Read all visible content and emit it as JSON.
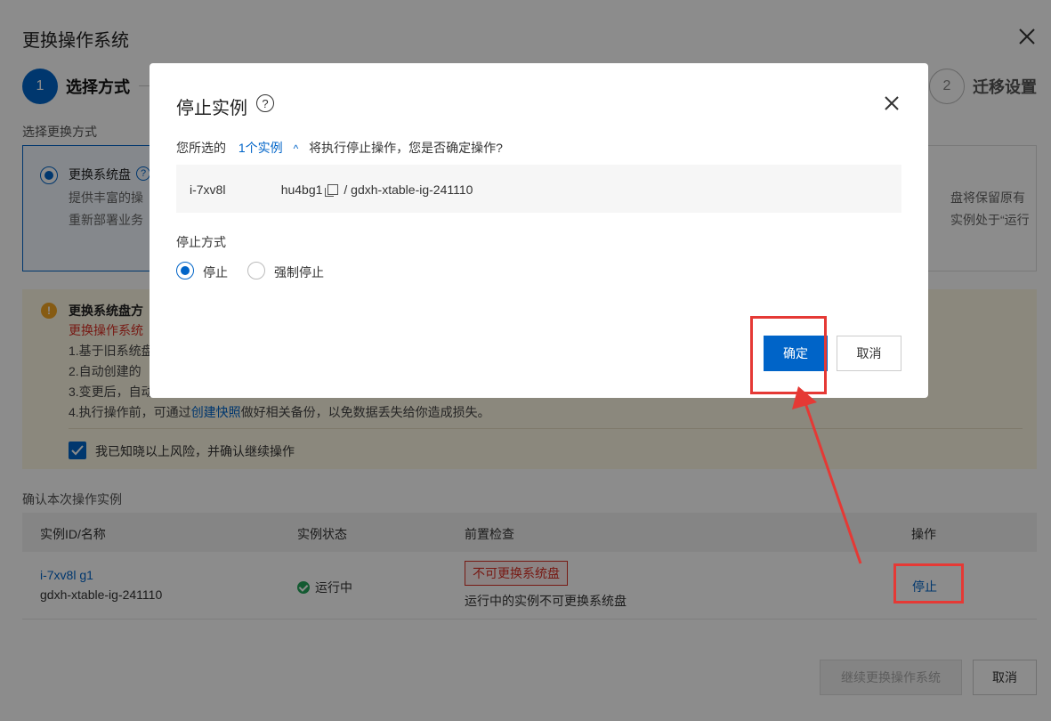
{
  "background": {
    "title": "更换操作系统",
    "steps": [
      {
        "num": "1",
        "label": "选择方式"
      },
      {
        "num": "2",
        "label": "迁移设置"
      }
    ],
    "section_label": "选择更换方式",
    "option": {
      "title": "更换系统盘",
      "help": "?",
      "desc1": "提供丰富的操",
      "desc2": "重新部署业务",
      "right1": "盘将保留原有",
      "right2": "实例处于“运行"
    },
    "warning": {
      "title": "更换系统盘方",
      "red": "更换操作系统",
      "line1": "1.基于旧系统盘",
      "line2": "2.自动创建的",
      "line3": "3.变更后，自动",
      "line4_pre": "4.执行操作前，可通过",
      "line4_link": "创建快照",
      "line4_post": "做好相关备份，以免数据丢失给你造成损失。",
      "check_label": "我已知晓以上风险，并确认继续操作"
    },
    "confirm_label": "确认本次操作实例",
    "table": {
      "headers": [
        "实例ID/名称",
        "实例状态",
        "前置检查",
        "操作"
      ],
      "row": {
        "id": "i-7xv8l                g1",
        "name": "gdxh-xtable-ig-241110",
        "status": "运行中",
        "tag": "不可更换系统盘",
        "check_desc": "运行中的实例不可更换系统盘",
        "action": "停止"
      }
    },
    "btn_continue": "继续更换操作系统",
    "btn_cancel": "取消"
  },
  "modal": {
    "title": "停止实例",
    "help": "?",
    "line_pre": "您所选的",
    "line_count": "1个实例",
    "line_post": "将执行停止操作，您是否确定操作?",
    "instance_id": "i-7xv8l                hu4bg1",
    "instance_name": "/ gdxh-xtable-ig-241110",
    "stop_mode_label": "停止方式",
    "options": [
      "停止",
      "强制停止"
    ],
    "selected_option": "停止",
    "ok": "确定",
    "cancel": "取消"
  },
  "colors": {
    "primary": "#0064c8",
    "annotation": "#e53935",
    "danger": "#d93026"
  }
}
